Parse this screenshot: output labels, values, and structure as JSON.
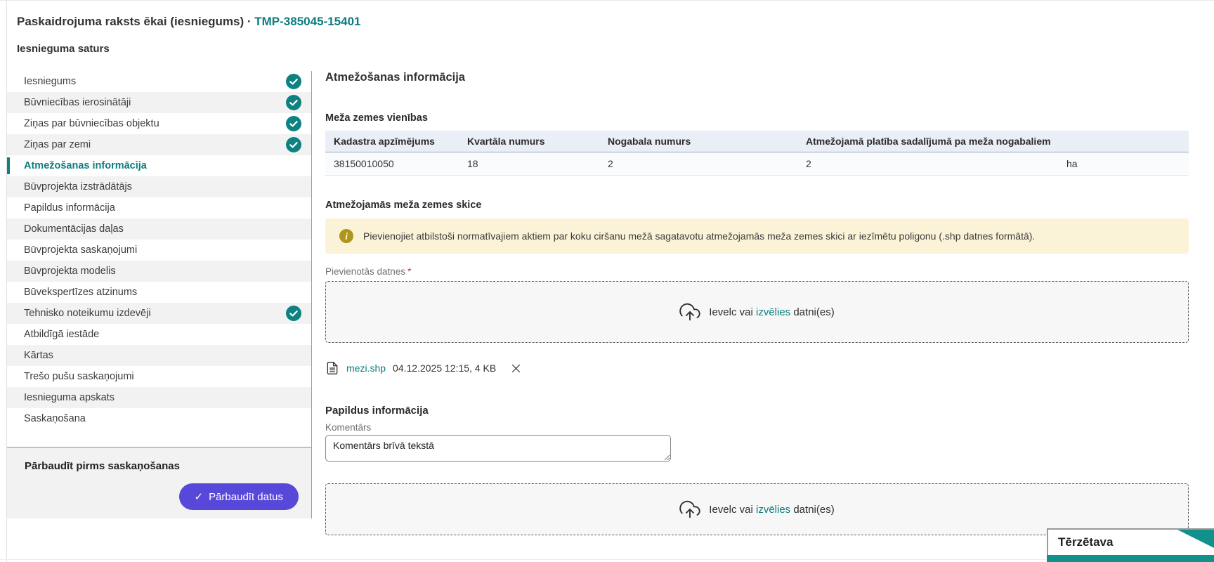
{
  "header": {
    "title": "Paskaidrojuma raksts ēkai (iesniegums)",
    "separator": " · ",
    "doc_number": "TMP-385045-15401"
  },
  "sidebar": {
    "title": "Iesnieguma saturs",
    "items": [
      {
        "label": "Iesniegums",
        "checked": true,
        "active": false
      },
      {
        "label": "Būvniecības ierosinātāji",
        "checked": true,
        "active": false
      },
      {
        "label": "Ziņas par būvniecības objektu",
        "checked": true,
        "active": false
      },
      {
        "label": "Ziņas par zemi",
        "checked": true,
        "active": false
      },
      {
        "label": "Atmežošanas informācija",
        "checked": false,
        "active": true
      },
      {
        "label": "Būvprojekta izstrādātājs",
        "checked": false,
        "active": false
      },
      {
        "label": "Papildus informācija",
        "checked": false,
        "active": false
      },
      {
        "label": "Dokumentācijas daļas",
        "checked": false,
        "active": false
      },
      {
        "label": "Būvprojekta saskaņojumi",
        "checked": false,
        "active": false
      },
      {
        "label": "Būvprojekta modelis",
        "checked": false,
        "active": false
      },
      {
        "label": "Būvekspertīzes atzinums",
        "checked": false,
        "active": false
      },
      {
        "label": "Tehnisko noteikumu izdevēji",
        "checked": true,
        "active": false
      },
      {
        "label": "Atbildīgā iestāde",
        "checked": false,
        "active": false
      },
      {
        "label": "Kārtas",
        "checked": false,
        "active": false
      },
      {
        "label": "Trešo pušu saskaņojumi",
        "checked": false,
        "active": false
      },
      {
        "label": "Iesnieguma apskats",
        "checked": false,
        "active": false
      },
      {
        "label": "Saskaņošana",
        "checked": false,
        "active": false
      }
    ],
    "footer": {
      "title": "Pārbaudīt pirms saskaņošanas",
      "button_label": "Pārbaudīt datus",
      "button_icon": "✓"
    }
  },
  "main": {
    "title": "Atmežošanas informācija",
    "forest_table": {
      "title": "Meža zemes vienības",
      "columns": [
        "Kadastra apzīmējums",
        "Kvartāla numurs",
        "Nogabala numurs",
        "Atmežojamā platība sadalījumā pa meža nogabaliem"
      ],
      "rows": [
        {
          "kadastrs": "38150010050",
          "kvartals": "18",
          "nogabals": "2",
          "platiba": "2",
          "unit": "ha"
        }
      ]
    },
    "sketch": {
      "title": "Atmežojamās meža zemes skice",
      "banner_icon": "i",
      "banner_text": "Pievienojiet atbilstoši normatīvajiem aktiem par koku ciršanu mežā sagatavotu atmežojamās meža zemes skici ar iezīmētu poligonu (.shp datnes formātā).",
      "files_label": "Pievienotās datnes",
      "required_mark": "*",
      "upload": {
        "prefix": "Ievelc vai",
        "link": "izvēlies",
        "suffix": "datni(es)"
      },
      "file": {
        "name": "mezi.shp",
        "meta": "04.12.2025 12:15, 4 KB"
      }
    },
    "additional": {
      "title": "Papildus informācija",
      "comment_label": "Komentārs",
      "comment_value": "Komentārs brīvā tekstā",
      "upload": {
        "prefix": "Ievelc vai",
        "link": "izvēlies",
        "suffix": "datni(es)"
      }
    }
  },
  "chat": {
    "title": "Tērzētava"
  },
  "colors": {
    "accent_teal": "#0c7d7d",
    "check_circle": "#0e8181",
    "button_purple": "#5748d9",
    "table_header_bg": "#e9eef7",
    "banner_bg": "#fbf3d7",
    "banner_icon": "#b0951c",
    "chat_teal": "#12918c"
  }
}
